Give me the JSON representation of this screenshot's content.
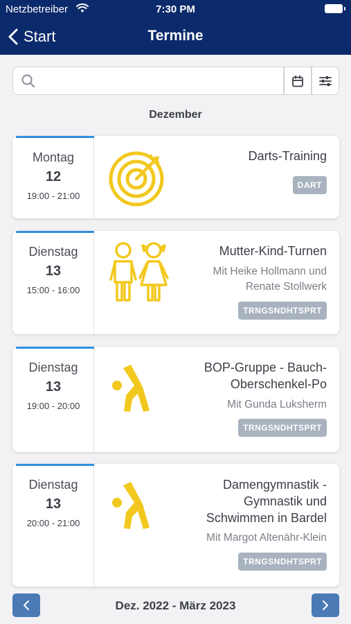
{
  "status_bar": {
    "carrier": "Netzbetreiber",
    "time": "7:30 PM"
  },
  "nav": {
    "back_label": "Start",
    "title": "Termine"
  },
  "search": {
    "placeholder": ""
  },
  "month_heading": "Dezember",
  "events": [
    {
      "weekday": "Montag",
      "day": "12",
      "time": "19:00 - 21:00",
      "title_lines": [
        "Darts-Training"
      ],
      "subtitle_lines": [],
      "tag": "DART",
      "icon": "target-icon"
    },
    {
      "weekday": "Dienstag",
      "day": "13",
      "time": "15:00 - 16:00",
      "title_lines": [
        "Mutter-Kind-Turnen"
      ],
      "subtitle_lines": [
        "Mit Heike Hollmann und",
        "Renate Stollwerk"
      ],
      "tag": "TRNGSNDHTSPRT",
      "icon": "children-icon"
    },
    {
      "weekday": "Dienstag",
      "day": "13",
      "time": "19:00 - 20:00",
      "title_lines": [
        "BOP-Gruppe - Bauch-",
        "Oberschenkel-Po"
      ],
      "subtitle_lines": [
        "Mit Gunda Luksherm"
      ],
      "tag": "TRNGSNDHTSPRT",
      "icon": "exercise-icon"
    },
    {
      "weekday": "Dienstag",
      "day": "13",
      "time": "20:00 - 21:00",
      "title_lines": [
        "Damengymnastik -",
        "Gymnastik und",
        "Schwimmen in Bardel"
      ],
      "subtitle_lines": [
        "Mit Margot Altenähr-Klein"
      ],
      "tag": "TRNGSNDHTSPRT",
      "icon": "exercise-icon"
    }
  ],
  "pager": {
    "label": "Dez. 2022 - März 2023"
  },
  "colors": {
    "header": "#0b2a6b",
    "accent": "#2e8fe0",
    "icon_yellow": "#f2c81e",
    "tag_bg": "#a8b3bf",
    "pager_button": "#4b7ab5"
  }
}
